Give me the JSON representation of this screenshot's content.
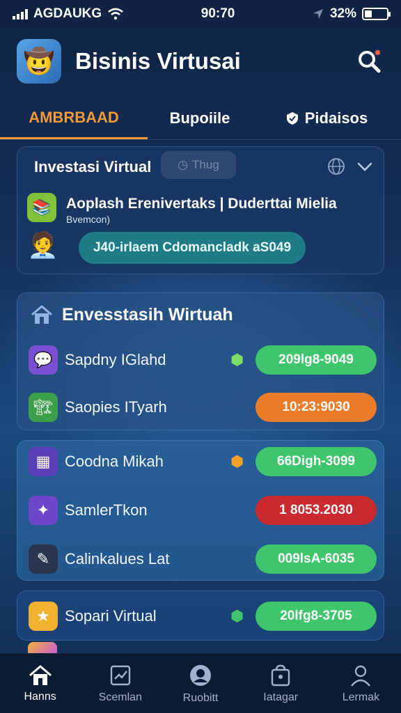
{
  "status_bar": {
    "carrier": "AGDAUKG",
    "time": "90:70",
    "battery_percent": "32%",
    "battery_level": 0.32
  },
  "header": {
    "title": "Bisinis Virtusai"
  },
  "tabs": [
    {
      "label": "AMBRBAAD",
      "active": true
    },
    {
      "label": "Bupoiile",
      "active": false
    },
    {
      "label": "Pidaisos",
      "active": false
    }
  ],
  "card_top": {
    "title": "Investasi Virtual",
    "ghost_button": "Thug",
    "line1": "Aoplash Erenivertaks | Duderttai Mielia",
    "line2": "Bvemcon)",
    "pill": "J40-irlaem Cdomancladk aS049"
  },
  "section": {
    "title": "Envesstasih Wirtuah",
    "rows": [
      {
        "label": "Sapdny IGlahd",
        "value": "209lg8-9049",
        "pill_color": "#3fc56c",
        "icon_bg": "#7b4fd1",
        "icon_glyph": "💬",
        "tag_glyph": "⬢",
        "tag_color": "#7edc66"
      },
      {
        "label": "Saopies ITyarh",
        "value": "10:23:9030",
        "pill_color": "#ec7b2a",
        "icon_bg": "#3c9f4a",
        "icon_glyph": "🏗",
        "tag_glyph": "",
        "tag_color": ""
      }
    ]
  },
  "section2": {
    "rows": [
      {
        "label": "Coodna Mikah",
        "value": "66Digh-3099",
        "pill_color": "#3fc56c",
        "icon_bg": "#5a3fb8",
        "icon_glyph": "▦",
        "tag_glyph": "⬢",
        "tag_color": "#f0a227"
      },
      {
        "label": "SamlerTkon",
        "value": "1 8053.2030",
        "pill_color": "#c92a2f",
        "icon_bg": "#6d49c9",
        "icon_glyph": "✦",
        "tag_glyph": "",
        "tag_color": ""
      },
      {
        "label": "Calinkalues Lat",
        "value": "009lsA-6035",
        "pill_color": "#3fc56c",
        "icon_bg": "#2a3550",
        "icon_glyph": "✎",
        "tag_glyph": "",
        "tag_color": ""
      }
    ]
  },
  "section3": {
    "rows": [
      {
        "label": "Sopari Virtual",
        "value": "20lfg8-3705",
        "pill_color": "#3fc56c",
        "icon_bg": "#f2b230",
        "icon_glyph": "★",
        "tag_glyph": "⬢",
        "tag_color": "#3fc56c"
      }
    ]
  },
  "bottom_nav": [
    {
      "label": "Hanns",
      "icon": "home-icon",
      "active": true
    },
    {
      "label": "Scemlan",
      "icon": "portfolio-icon",
      "active": false
    },
    {
      "label": "Ruobitt",
      "icon": "support-icon",
      "active": false
    },
    {
      "label": "Iatagar",
      "icon": "store-icon",
      "active": false
    },
    {
      "label": "Lermak",
      "icon": "profile-icon",
      "active": false
    }
  ]
}
